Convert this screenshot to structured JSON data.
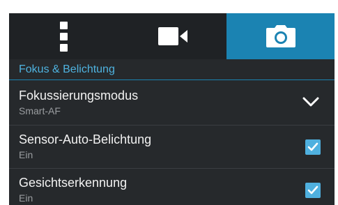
{
  "tabs": [
    {
      "name": "more",
      "icon": "more-vertical-icon",
      "active": false
    },
    {
      "name": "video",
      "icon": "video-camera-icon",
      "active": false
    },
    {
      "name": "photo",
      "icon": "camera-icon",
      "active": true
    }
  ],
  "section": {
    "title": "Fokus & Belichtung"
  },
  "settings": [
    {
      "title": "Fokussierungsmodus",
      "value": "Smart-AF",
      "control": "chevron-down-icon"
    },
    {
      "title": "Sensor-Auto-Belichtung",
      "value": "Ein",
      "control": "checkbox",
      "checked": true
    },
    {
      "title": "Gesichtserkennung",
      "value": "Ein",
      "control": "checkbox",
      "checked": true
    }
  ],
  "colors": {
    "accent": "#1b83b2",
    "section_text": "#4fb3e0",
    "checkbox": "#4fb0df",
    "background": "#26292c"
  }
}
